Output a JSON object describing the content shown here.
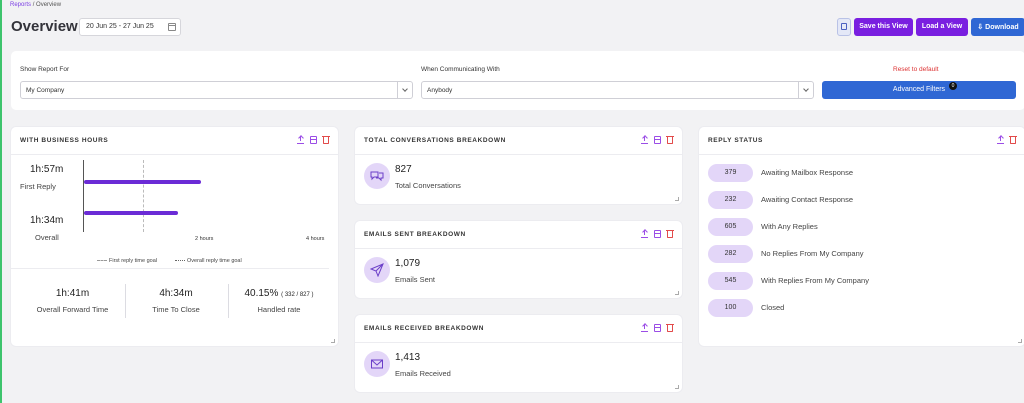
{
  "breadcrumb": {
    "parent": "Reports",
    "separator": "/",
    "current": "Overview"
  },
  "header": {
    "title": "Overview",
    "date_range": "20 Jun 25 - 27 Jun 25",
    "save_view": "Save this View",
    "load_view": "Load a View",
    "download": "Download"
  },
  "filters": {
    "report_for_label": "Show Report For",
    "report_for_value": "My Company",
    "communicating_label": "When Communicating With",
    "communicating_value": "Anybody",
    "reset": "Reset to default",
    "advanced": "Advanced Filters",
    "advanced_count": "0"
  },
  "business_hours": {
    "title": "WITH BUSINESS HOURS",
    "rows": [
      {
        "value": "1h:57m",
        "label": "First Reply"
      },
      {
        "value": "1h:34m",
        "label": "Overall"
      }
    ],
    "ticks": [
      "2 hours",
      "4 hours"
    ],
    "legend": [
      "First reply time goal",
      "Overall reply time goal"
    ],
    "stats": [
      {
        "value": "1h:41m",
        "label": "Overall Forward Time"
      },
      {
        "value": "4h:34m",
        "label": "Time To Close"
      },
      {
        "value": "40.15%",
        "detail": "( 332 / 827 )",
        "label": "Handled rate"
      }
    ]
  },
  "chart_data": {
    "type": "bar",
    "orientation": "horizontal",
    "categories": [
      "First Reply",
      "Overall"
    ],
    "values": [
      117,
      94
    ],
    "unit": "minutes",
    "xlim": [
      0,
      240
    ],
    "xticks": [
      "2 hours",
      "4 hours"
    ]
  },
  "total_conversations": {
    "title": "TOTAL CONVERSATIONS BREAKDOWN",
    "value": "827",
    "label": "Total Conversations"
  },
  "emails_sent": {
    "title": "EMAILS SENT BREAKDOWN",
    "value": "1,079",
    "label": "Emails Sent"
  },
  "emails_received": {
    "title": "EMAILS RECEIVED BREAKDOWN",
    "value": "1,413",
    "label": "Emails Received"
  },
  "reply_status": {
    "title": "REPLY STATUS",
    "rows": [
      {
        "count": "379",
        "label": "Awaiting Mailbox Response"
      },
      {
        "count": "232",
        "label": "Awaiting Contact Response"
      },
      {
        "count": "605",
        "label": "With Any Replies"
      },
      {
        "count": "282",
        "label": "No Replies From My Company"
      },
      {
        "count": "545",
        "label": "With Replies From My Company"
      },
      {
        "count": "100",
        "label": "Closed"
      }
    ]
  },
  "colors": {
    "primary": "#7a1fe0",
    "blue": "#2f67d4",
    "bar": "#6b2bd6",
    "pill": "#e3d6f8",
    "danger": "#dd3333"
  }
}
